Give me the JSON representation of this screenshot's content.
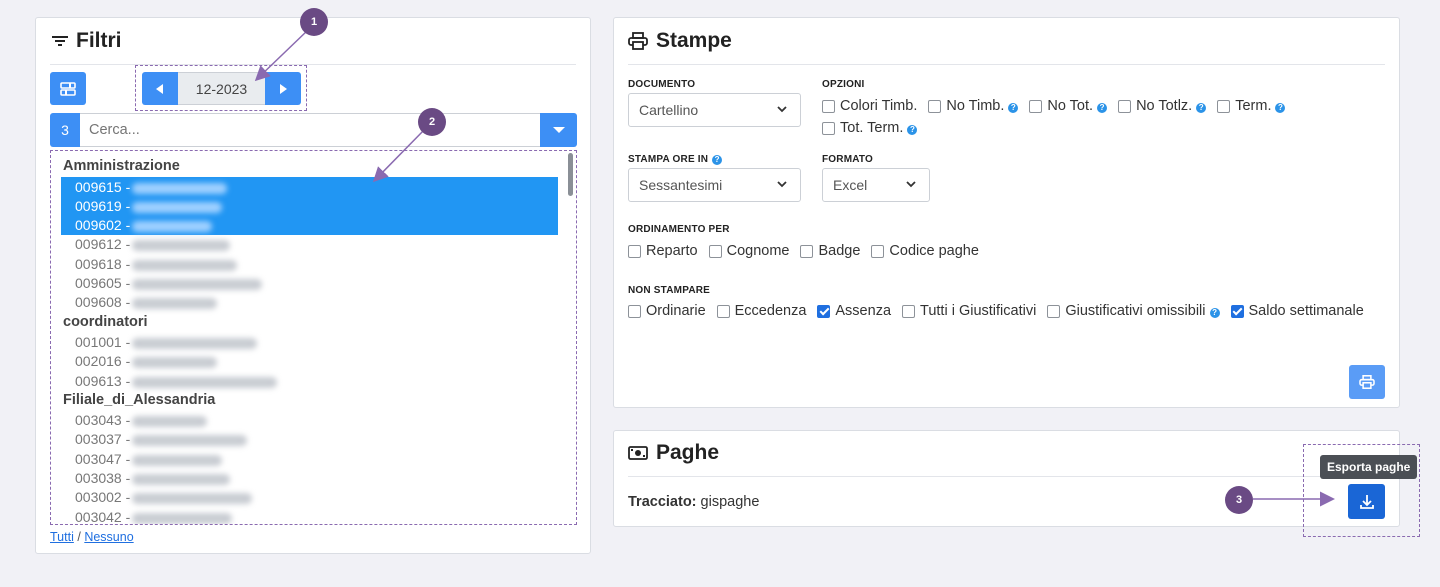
{
  "filtri": {
    "title": "Filtri",
    "period": "12-2023",
    "count_badge": "3",
    "search_placeholder": "Cerca...",
    "groups": [
      {
        "name": "Amministrazione",
        "items": [
          {
            "code": "009615 -",
            "selected": true
          },
          {
            "code": "009619 -",
            "selected": true
          },
          {
            "code": "009602 -",
            "selected": true
          },
          {
            "code": "009612 -",
            "selected": false
          },
          {
            "code": "009618 -",
            "selected": false
          },
          {
            "code": "009605 -",
            "selected": false
          },
          {
            "code": "009608 -",
            "selected": false
          }
        ]
      },
      {
        "name": "coordinatori",
        "items": [
          {
            "code": "001001 -",
            "selected": false
          },
          {
            "code": "002016 -",
            "selected": false
          },
          {
            "code": "009613 -",
            "selected": false
          }
        ]
      },
      {
        "name": "Filiale_di_Alessandria",
        "items": [
          {
            "code": "003043 -",
            "selected": false
          },
          {
            "code": "003037 -",
            "selected": false
          },
          {
            "code": "003047 -",
            "selected": false
          },
          {
            "code": "003038 -",
            "selected": false
          },
          {
            "code": "003002 -",
            "selected": false
          },
          {
            "code": "003042 -",
            "selected": false
          }
        ]
      }
    ],
    "link_all": "Tutti",
    "link_sep": "/",
    "link_none": "Nessuno"
  },
  "stampe": {
    "title": "Stampe",
    "documento_label": "DOCUMENTO",
    "documento_value": "Cartellino",
    "opzioni_label": "OPZIONI",
    "opzioni": [
      {
        "label": "Colori Timb.",
        "checked": false,
        "help": false
      },
      {
        "label": "No Timb.",
        "checked": false,
        "help": true
      },
      {
        "label": "No Tot.",
        "checked": false,
        "help": true
      },
      {
        "label": "No Totlz.",
        "checked": false,
        "help": true
      },
      {
        "label": "Term.",
        "checked": false,
        "help": true
      },
      {
        "label": "Tot. Term.",
        "checked": false,
        "help": true
      }
    ],
    "stampa_ore_label": "STAMPA ORE IN",
    "stampa_ore_value": "Sessantesimi",
    "formato_label": "FORMATO",
    "formato_value": "Excel",
    "ordinamento_label": "ORDINAMENTO PER",
    "ordinamento": [
      {
        "label": "Reparto",
        "checked": false
      },
      {
        "label": "Cognome",
        "checked": false
      },
      {
        "label": "Badge",
        "checked": false
      },
      {
        "label": "Codice paghe",
        "checked": false
      }
    ],
    "non_stampare_label": "NON STAMPARE",
    "non_stampare": [
      {
        "label": "Ordinarie",
        "checked": false,
        "help": false
      },
      {
        "label": "Eccedenza",
        "checked": false,
        "help": false
      },
      {
        "label": "Assenza",
        "checked": true,
        "help": false
      },
      {
        "label": "Tutti i Giustificativi",
        "checked": false,
        "help": false
      },
      {
        "label": "Giustificativi omissibili",
        "checked": false,
        "help": true
      },
      {
        "label": "Saldo settimanale",
        "checked": true,
        "help": false
      }
    ]
  },
  "paghe": {
    "title": "Paghe",
    "tracciato_label": "Tracciato:",
    "tracciato_value": "gispaghe",
    "export_tooltip": "Esporta paghe"
  },
  "markers": [
    "1",
    "2",
    "3"
  ],
  "colors": {
    "accent": "#3d8ff5",
    "selection": "#2196f3",
    "export_button": "#1a66d6",
    "marker": "#6a4a84"
  }
}
